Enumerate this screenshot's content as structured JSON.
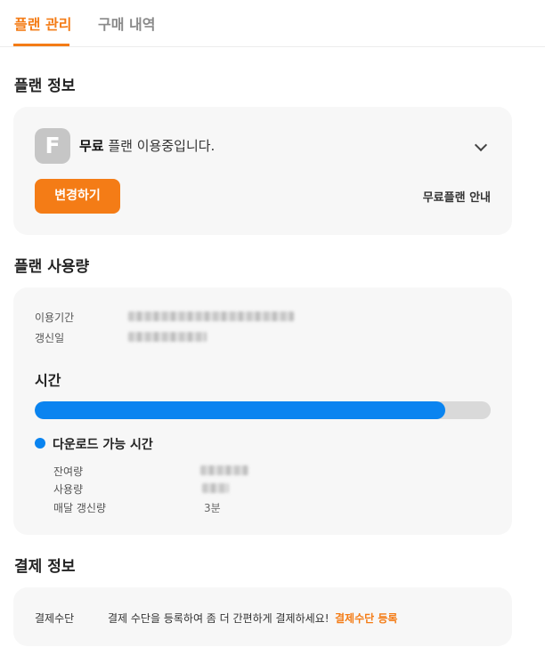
{
  "tabs": [
    {
      "label": "플랜 관리",
      "active": true
    },
    {
      "label": "구매 내역",
      "active": false
    }
  ],
  "plan_info": {
    "section_title": "플랜 정보",
    "badge_letter": "F",
    "plan_name": "무료",
    "plan_suffix": " 플랜 이용중입니다.",
    "change_button": "변경하기",
    "guide_link": "무료플랜 안내"
  },
  "usage": {
    "section_title": "플랜 사용량",
    "period_label": "이용기간",
    "renewal_label": "갱신일",
    "time_title": "시간",
    "progress_fraction": 0.9,
    "legend_label": "다운로드 가능 시간",
    "remaining_label": "잔여량",
    "used_label": "사용량",
    "monthly_label": "매달 갱신량",
    "monthly_value": "3분"
  },
  "payment": {
    "section_title": "결제 정보",
    "method_label": "결제수단",
    "description": "결제 수단을 등록하여 좀 더 간편하게 결제하세요!",
    "register_link": "결제수단 등록"
  },
  "colors": {
    "accent": "#f47c16",
    "progress": "#0a84f0",
    "card_bg": "#f7f7f7"
  }
}
